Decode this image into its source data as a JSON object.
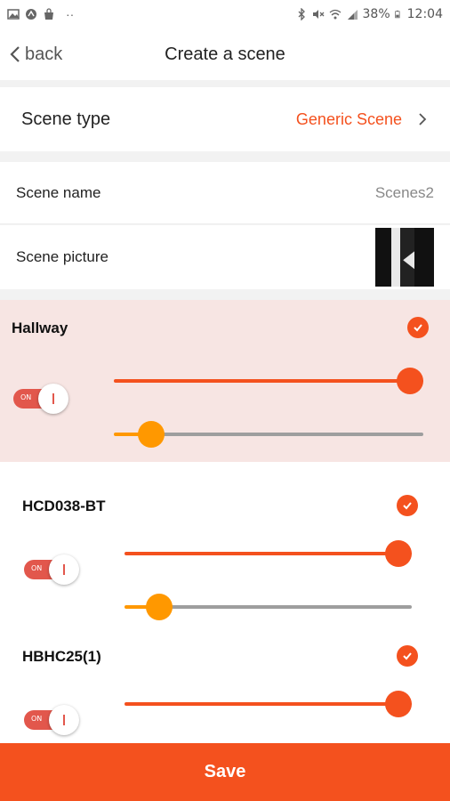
{
  "status_bar": {
    "battery": "38%",
    "time": "12:04"
  },
  "header": {
    "back_label": "back",
    "title": "Create a scene"
  },
  "scene_type": {
    "label": "Scene type",
    "value": "Generic Scene"
  },
  "scene_name": {
    "label": "Scene name",
    "value": "Scenes2"
  },
  "scene_picture": {
    "label": "Scene picture"
  },
  "devices": [
    {
      "name": "Hallway",
      "selected": true,
      "toggle_label": "ON",
      "brightness": 1.0,
      "color_temp": 0.12
    },
    {
      "name": "HCD038-BT",
      "selected": true,
      "toggle_label": "ON",
      "brightness": 1.0,
      "color_temp": 0.12
    },
    {
      "name": "HBHC25(1)",
      "selected": true,
      "toggle_label": "ON",
      "brightness": 1.0
    }
  ],
  "save_label": "Save",
  "colors": {
    "accent": "#f4511e",
    "slider_orange": "#ff9800",
    "selected_bg": "#f7e5e3"
  }
}
